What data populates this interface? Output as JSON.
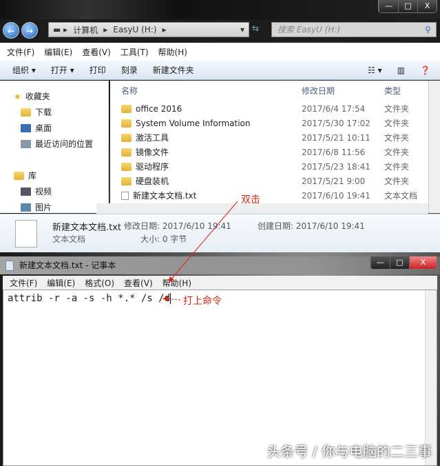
{
  "explorer": {
    "window_buttons": [
      "—",
      "□",
      "X"
    ],
    "breadcrumb": [
      "计算机",
      "EasyU (H:)"
    ],
    "search_placeholder": "搜索 EasyU (H:)",
    "menu": [
      "文件(F)",
      "编辑(E)",
      "查看(V)",
      "工具(T)",
      "帮助(H)"
    ],
    "toolbar": [
      "组织 ▾",
      "打开 ▾",
      "打印",
      "刻录",
      "新建文件夹"
    ],
    "nav": [
      {
        "label": "收藏夹"
      },
      {
        "label": "下载"
      },
      {
        "label": "桌面"
      },
      {
        "label": "最近访问的位置"
      },
      {
        "label": "库"
      },
      {
        "label": "视频"
      },
      {
        "label": "图片"
      }
    ],
    "columns": [
      "名称",
      "修改日期",
      "类型"
    ],
    "files": [
      {
        "name": "office 2016",
        "date": "2017/6/4 17:54",
        "type": "文件夹"
      },
      {
        "name": "System Volume Information",
        "date": "2017/5/30 17:02",
        "type": "文件夹"
      },
      {
        "name": "激活工具",
        "date": "2017/5/21 10:11",
        "type": "文件夹"
      },
      {
        "name": "镜像文件",
        "date": "2017/6/8 11:56",
        "type": "文件夹"
      },
      {
        "name": "驱动程序",
        "date": "2017/5/23 18:41",
        "type": "文件夹"
      },
      {
        "name": "硬盘装机",
        "date": "2017/5/21 9:00",
        "type": "文件夹"
      },
      {
        "name": "新建文本文档.txt",
        "date": "2017/6/10 19:41",
        "type": "文本文档"
      }
    ],
    "details": {
      "name": "新建文本文档.txt",
      "modified": "修改日期: 2017/6/10 19:41",
      "created": "创建日期: 2017/6/10 19:41",
      "type": "文本文档",
      "size": "大小: 0 字节"
    }
  },
  "notepad": {
    "title": "新建文本文档.txt - 记事本",
    "menu": [
      "文件(F)",
      "编辑(E)",
      "格式(O)",
      "查看(V)",
      "帮助(H)"
    ],
    "content": "attrib -r -a -s -h *.* /s /d"
  },
  "annotations": {
    "double_click": "双击",
    "type_command": "打上命令"
  },
  "watermark": "头条号 / 你与电脑的二三事"
}
